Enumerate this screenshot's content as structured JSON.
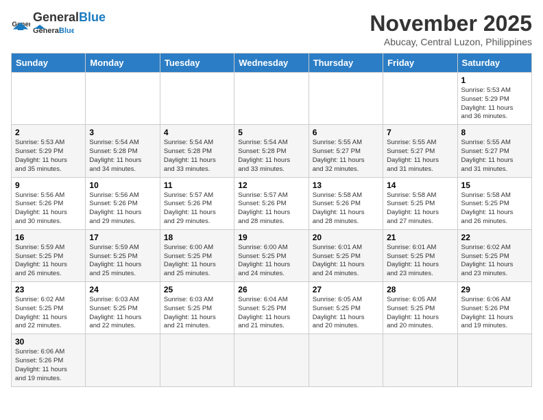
{
  "header": {
    "logo_general": "General",
    "logo_blue": "Blue",
    "month_year": "November 2025",
    "location": "Abucay, Central Luzon, Philippines"
  },
  "weekdays": [
    "Sunday",
    "Monday",
    "Tuesday",
    "Wednesday",
    "Thursday",
    "Friday",
    "Saturday"
  ],
  "weeks": [
    [
      {
        "day": "",
        "info": ""
      },
      {
        "day": "",
        "info": ""
      },
      {
        "day": "",
        "info": ""
      },
      {
        "day": "",
        "info": ""
      },
      {
        "day": "",
        "info": ""
      },
      {
        "day": "",
        "info": ""
      },
      {
        "day": "1",
        "info": "Sunrise: 5:53 AM\nSunset: 5:29 PM\nDaylight: 11 hours\nand 36 minutes."
      }
    ],
    [
      {
        "day": "2",
        "info": "Sunrise: 5:53 AM\nSunset: 5:29 PM\nDaylight: 11 hours\nand 35 minutes."
      },
      {
        "day": "3",
        "info": "Sunrise: 5:54 AM\nSunset: 5:28 PM\nDaylight: 11 hours\nand 34 minutes."
      },
      {
        "day": "4",
        "info": "Sunrise: 5:54 AM\nSunset: 5:28 PM\nDaylight: 11 hours\nand 33 minutes."
      },
      {
        "day": "5",
        "info": "Sunrise: 5:54 AM\nSunset: 5:28 PM\nDaylight: 11 hours\nand 33 minutes."
      },
      {
        "day": "6",
        "info": "Sunrise: 5:55 AM\nSunset: 5:27 PM\nDaylight: 11 hours\nand 32 minutes."
      },
      {
        "day": "7",
        "info": "Sunrise: 5:55 AM\nSunset: 5:27 PM\nDaylight: 11 hours\nand 31 minutes."
      },
      {
        "day": "8",
        "info": "Sunrise: 5:55 AM\nSunset: 5:27 PM\nDaylight: 11 hours\nand 31 minutes."
      }
    ],
    [
      {
        "day": "9",
        "info": "Sunrise: 5:56 AM\nSunset: 5:26 PM\nDaylight: 11 hours\nand 30 minutes."
      },
      {
        "day": "10",
        "info": "Sunrise: 5:56 AM\nSunset: 5:26 PM\nDaylight: 11 hours\nand 29 minutes."
      },
      {
        "day": "11",
        "info": "Sunrise: 5:57 AM\nSunset: 5:26 PM\nDaylight: 11 hours\nand 29 minutes."
      },
      {
        "day": "12",
        "info": "Sunrise: 5:57 AM\nSunset: 5:26 PM\nDaylight: 11 hours\nand 28 minutes."
      },
      {
        "day": "13",
        "info": "Sunrise: 5:58 AM\nSunset: 5:26 PM\nDaylight: 11 hours\nand 28 minutes."
      },
      {
        "day": "14",
        "info": "Sunrise: 5:58 AM\nSunset: 5:25 PM\nDaylight: 11 hours\nand 27 minutes."
      },
      {
        "day": "15",
        "info": "Sunrise: 5:58 AM\nSunset: 5:25 PM\nDaylight: 11 hours\nand 26 minutes."
      }
    ],
    [
      {
        "day": "16",
        "info": "Sunrise: 5:59 AM\nSunset: 5:25 PM\nDaylight: 11 hours\nand 26 minutes."
      },
      {
        "day": "17",
        "info": "Sunrise: 5:59 AM\nSunset: 5:25 PM\nDaylight: 11 hours\nand 25 minutes."
      },
      {
        "day": "18",
        "info": "Sunrise: 6:00 AM\nSunset: 5:25 PM\nDaylight: 11 hours\nand 25 minutes."
      },
      {
        "day": "19",
        "info": "Sunrise: 6:00 AM\nSunset: 5:25 PM\nDaylight: 11 hours\nand 24 minutes."
      },
      {
        "day": "20",
        "info": "Sunrise: 6:01 AM\nSunset: 5:25 PM\nDaylight: 11 hours\nand 24 minutes."
      },
      {
        "day": "21",
        "info": "Sunrise: 6:01 AM\nSunset: 5:25 PM\nDaylight: 11 hours\nand 23 minutes."
      },
      {
        "day": "22",
        "info": "Sunrise: 6:02 AM\nSunset: 5:25 PM\nDaylight: 11 hours\nand 23 minutes."
      }
    ],
    [
      {
        "day": "23",
        "info": "Sunrise: 6:02 AM\nSunset: 5:25 PM\nDaylight: 11 hours\nand 22 minutes."
      },
      {
        "day": "24",
        "info": "Sunrise: 6:03 AM\nSunset: 5:25 PM\nDaylight: 11 hours\nand 22 minutes."
      },
      {
        "day": "25",
        "info": "Sunrise: 6:03 AM\nSunset: 5:25 PM\nDaylight: 11 hours\nand 21 minutes."
      },
      {
        "day": "26",
        "info": "Sunrise: 6:04 AM\nSunset: 5:25 PM\nDaylight: 11 hours\nand 21 minutes."
      },
      {
        "day": "27",
        "info": "Sunrise: 6:05 AM\nSunset: 5:25 PM\nDaylight: 11 hours\nand 20 minutes."
      },
      {
        "day": "28",
        "info": "Sunrise: 6:05 AM\nSunset: 5:25 PM\nDaylight: 11 hours\nand 20 minutes."
      },
      {
        "day": "29",
        "info": "Sunrise: 6:06 AM\nSunset: 5:26 PM\nDaylight: 11 hours\nand 19 minutes."
      }
    ],
    [
      {
        "day": "30",
        "info": "Sunrise: 6:06 AM\nSunset: 5:26 PM\nDaylight: 11 hours\nand 19 minutes."
      },
      {
        "day": "",
        "info": ""
      },
      {
        "day": "",
        "info": ""
      },
      {
        "day": "",
        "info": ""
      },
      {
        "day": "",
        "info": ""
      },
      {
        "day": "",
        "info": ""
      },
      {
        "day": "",
        "info": ""
      }
    ]
  ]
}
